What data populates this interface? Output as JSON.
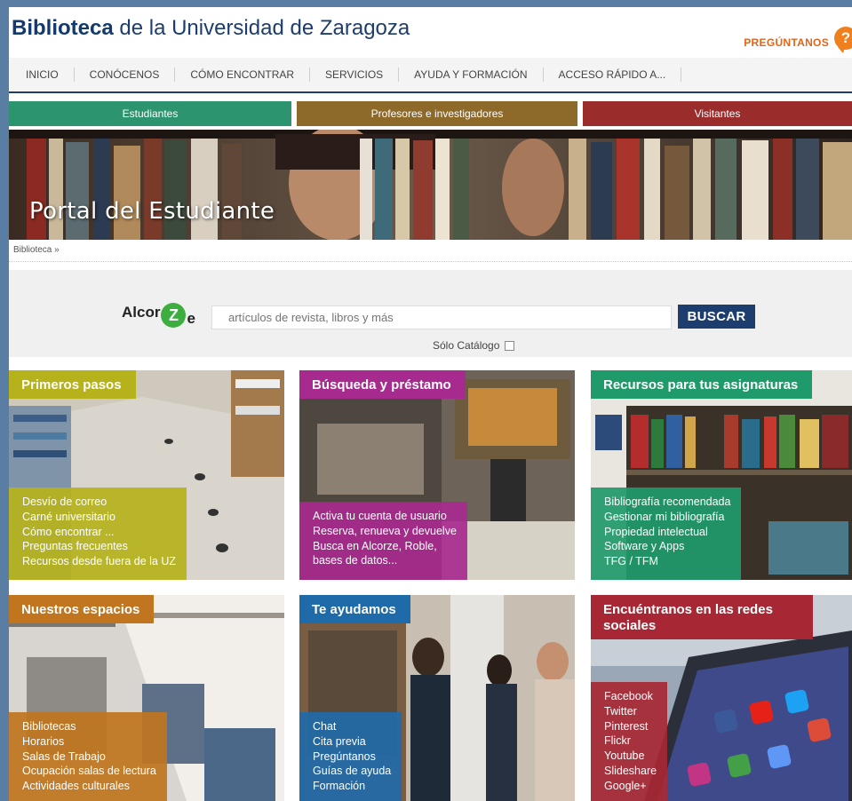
{
  "header": {
    "title_bold": "Biblioteca",
    "title_rest": " de la Universidad de Zaragoza",
    "ask_label": "PREGÚNTANOS",
    "ask_icon_glyph": "?"
  },
  "nav": [
    "INICIO",
    "CONÓCENOS",
    "CÓMO ENCONTRAR",
    "SERVICIOS",
    "AYUDA Y FORMACIÓN",
    "ACCESO RÁPIDO A..."
  ],
  "tabs": [
    {
      "label": "Estudiantes",
      "color": "#2d9470"
    },
    {
      "label": "Profesores e investigadores",
      "color": "#8d6a2a"
    },
    {
      "label": "Visitantes",
      "color": "#9b2c2c"
    }
  ],
  "banner": {
    "title": "Portal del Estudiante"
  },
  "breadcrumb": "Biblioteca »",
  "search": {
    "logo_left": "Alcor",
    "logo_z": "Z",
    "logo_right": "e",
    "placeholder": "artículos de revista, libros y más",
    "button": "BUSCAR",
    "catalog_label": "Sólo Catálogo"
  },
  "cards": [
    {
      "title": "Primeros pasos",
      "color": "#b5b21c",
      "links": [
        "Desvío de correo",
        "Carné universitario",
        "Cómo encontrar ...",
        "Preguntas frecuentes",
        "Recursos desde fuera de la UZ"
      ]
    },
    {
      "title": "Búsqueda y préstamo",
      "color": "#a72a8e",
      "links": [
        "Activa tu cuenta de usuario",
        "Reserva, renueva y devuelve",
        "Busca en Alcorze, Roble,",
        " bases de datos..."
      ]
    },
    {
      "title": "Recursos para tus asignaturas",
      "color": "#1f9a6a",
      "links": [
        "Bibliografía recomendada",
        "Gestionar mi bibliografía",
        "Propiedad intelectual",
        "Software y Apps",
        "TFG / TFM"
      ]
    },
    {
      "title": "Nuestros espacios",
      "color": "#c0751e",
      "links": [
        "Bibliotecas",
        "Horarios",
        "Salas de Trabajo",
        "Ocupación salas de lectura",
        "Actividades culturales"
      ]
    },
    {
      "title": "Te ayudamos",
      "color": "#1f6aa8",
      "links": [
        "Chat",
        "Cita previa",
        "Pregúntanos",
        "Guías de ayuda",
        "Formación"
      ]
    },
    {
      "title": "Encuéntranos en las redes sociales",
      "color": "#a72834",
      "links": [
        "Facebook",
        "Twitter",
        "Pinterest",
        "Flickr",
        "Youtube",
        "Slideshare",
        "Google+"
      ]
    }
  ]
}
